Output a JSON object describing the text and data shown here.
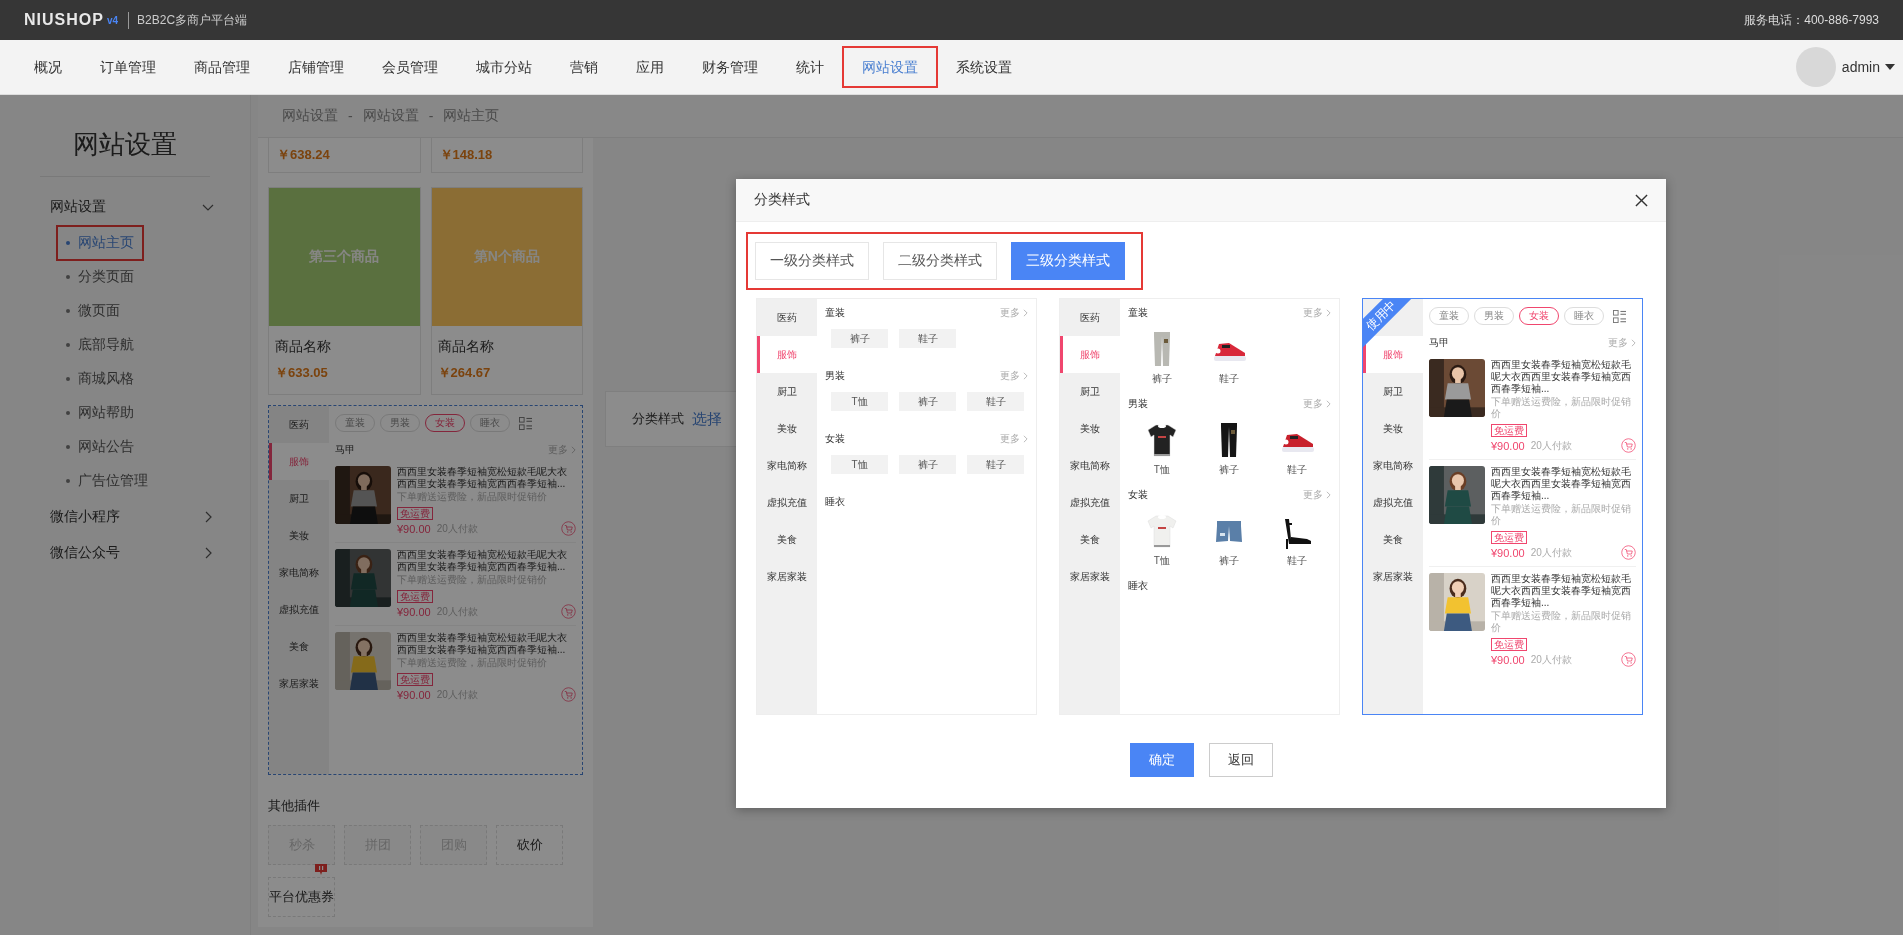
{
  "topbar": {
    "logo": "NIUSHOP",
    "version": "v4",
    "platform": "B2B2C多商户平台端",
    "phone": "服务电话：400-886-7993"
  },
  "nav": {
    "user": "admin",
    "items": [
      {
        "label": "概况",
        "selected": false,
        "annotated": false
      },
      {
        "label": "订单管理",
        "selected": false,
        "annotated": false
      },
      {
        "label": "商品管理",
        "selected": false,
        "annotated": false
      },
      {
        "label": "店铺管理",
        "selected": false,
        "annotated": false
      },
      {
        "label": "会员管理",
        "selected": false,
        "annotated": false
      },
      {
        "label": "城市分站",
        "selected": false,
        "annotated": false
      },
      {
        "label": "营销",
        "selected": false,
        "annotated": false
      },
      {
        "label": "应用",
        "selected": false,
        "annotated": false
      },
      {
        "label": "财务管理",
        "selected": false,
        "annotated": false
      },
      {
        "label": "统计",
        "selected": false,
        "annotated": false
      },
      {
        "label": "网站设置",
        "selected": true,
        "annotated": true
      },
      {
        "label": "系统设置",
        "selected": false,
        "annotated": false
      }
    ]
  },
  "sidebar": {
    "title": "网站设置",
    "groups": [
      {
        "label": "网站设置",
        "expanded": true,
        "children": [
          {
            "label": "网站主页",
            "selected": true,
            "annotated": true
          },
          {
            "label": "分类页面",
            "selected": false,
            "annotated": false
          },
          {
            "label": "微页面",
            "selected": false,
            "annotated": false
          },
          {
            "label": "底部导航",
            "selected": false,
            "annotated": false
          },
          {
            "label": "商城风格",
            "selected": false,
            "annotated": false
          },
          {
            "label": "网站帮助",
            "selected": false,
            "annotated": false
          },
          {
            "label": "网站公告",
            "selected": false,
            "annotated": false
          },
          {
            "label": "广告位管理",
            "selected": false,
            "annotated": false
          }
        ]
      },
      {
        "label": "微信小程序",
        "expanded": false
      },
      {
        "label": "微信公众号",
        "expanded": false
      }
    ]
  },
  "breadcrumb": {
    "separator": "-",
    "items": [
      "网站设置",
      "网站设置",
      "网站主页"
    ]
  },
  "products": {
    "top_prices": [
      "￥638.24",
      "￥148.18"
    ],
    "cards": [
      {
        "image_text": "第三个商品",
        "color": "#5b7040",
        "name": "商品名称",
        "price": "￥633.05"
      },
      {
        "image_text": "第N个商品",
        "color": "#8b6d34",
        "name": "商品名称",
        "price": "￥264.67"
      }
    ]
  },
  "preview": {
    "categories": [
      {
        "label": "医药",
        "selected": false
      },
      {
        "label": "服饰",
        "selected": true
      },
      {
        "label": "厨卫",
        "selected": false
      },
      {
        "label": "美妆",
        "selected": false
      },
      {
        "label": "家电简称",
        "selected": false
      },
      {
        "label": "虚拟充值",
        "selected": false
      },
      {
        "label": "美食",
        "selected": false
      },
      {
        "label": "家居家装",
        "selected": false
      }
    ],
    "tabs": [
      {
        "label": "童装",
        "selected": false
      },
      {
        "label": "男装",
        "selected": false
      },
      {
        "label": "女装",
        "selected": true
      },
      {
        "label": "睡衣",
        "selected": false
      }
    ],
    "section": {
      "title": "马甲",
      "more": "更多"
    },
    "products": [
      {
        "title": "西西里女装春季短袖宽松短款毛呢大衣西西里女装春季短袖宽西西春季短袖...",
        "subtitle": "下单赠送运费险，新品限时促销价",
        "tag": "免运费",
        "price": "¥90.00",
        "sales": "20人付款"
      },
      {
        "title": "西西里女装春季短袖宽松短款毛呢大衣西西里女装春季短袖宽西西春季短袖...",
        "subtitle": "下单赠送运费险，新品限时促销价",
        "tag": "免运费",
        "price": "¥90.00",
        "sales": "20人付款"
      },
      {
        "title": "西西里女装春季短袖宽松短款毛呢大衣西西里女装春季短袖宽西西春季短袖...",
        "subtitle": "下单赠送运费险，新品限时促销价",
        "tag": "免运费",
        "price": "¥90.00",
        "sales": "20人付款"
      }
    ]
  },
  "style_setting": {
    "label": "分类样式",
    "link": "选择"
  },
  "plugins": {
    "title": "其他插件",
    "items": [
      {
        "label": "秒杀",
        "disabled": true,
        "badge": false
      },
      {
        "label": "拼团",
        "disabled": true,
        "badge": false
      },
      {
        "label": "团购",
        "disabled": true,
        "badge": false
      },
      {
        "label": "砍价",
        "disabled": false,
        "badge": false
      },
      {
        "label": "平台优惠券",
        "disabled": false,
        "badge": true
      }
    ]
  },
  "modal": {
    "title": "分类样式",
    "annotated": true,
    "tabs": [
      {
        "label": "一级分类样式",
        "selected": false
      },
      {
        "label": "二级分类样式",
        "selected": false
      },
      {
        "label": "三级分类样式",
        "selected": true
      }
    ],
    "styles": [
      {
        "kind": "level1",
        "in_use": false,
        "categories": [
          {
            "label": "医药",
            "selected": false
          },
          {
            "label": "服饰",
            "selected": true
          },
          {
            "label": "厨卫",
            "selected": false
          },
          {
            "label": "美妆",
            "selected": false
          },
          {
            "label": "家电简称",
            "selected": false
          },
          {
            "label": "虚拟充值",
            "selected": false
          },
          {
            "label": "美食",
            "selected": false
          },
          {
            "label": "家居家装",
            "selected": false
          }
        ],
        "sections": [
          {
            "title": "童装",
            "more": "更多",
            "items": [
              "裤子",
              "鞋子"
            ]
          },
          {
            "title": "男装",
            "more": "更多",
            "items": [
              "T恤",
              "裤子",
              "鞋子"
            ]
          },
          {
            "title": "女装",
            "more": "更多",
            "items": [
              "T恤",
              "裤子",
              "鞋子"
            ]
          },
          {
            "title": "睡衣"
          }
        ]
      },
      {
        "kind": "level2",
        "in_use": false,
        "categories": [
          {
            "label": "医药",
            "selected": false
          },
          {
            "label": "服饰",
            "selected": true
          },
          {
            "label": "厨卫",
            "selected": false
          },
          {
            "label": "美妆",
            "selected": false
          },
          {
            "label": "家电简称",
            "selected": false
          },
          {
            "label": "虚拟充值",
            "selected": false
          },
          {
            "label": "美食",
            "selected": false
          },
          {
            "label": "家居家装",
            "selected": false
          }
        ],
        "sections": [
          {
            "title": "童装",
            "more": "更多",
            "items": [
              "裤子",
              "鞋子"
            ]
          },
          {
            "title": "男装",
            "more": "更多",
            "items": [
              "T恤",
              "裤子",
              "鞋子"
            ]
          },
          {
            "title": "女装",
            "more": "更多",
            "items": [
              "T恤",
              "裤子",
              "鞋子"
            ]
          },
          {
            "title": "睡衣"
          }
        ]
      },
      {
        "kind": "level3",
        "in_use": true,
        "badge": "使用中",
        "categories": [
          {
            "label": "服饰",
            "selected": true
          },
          {
            "label": "厨卫",
            "selected": false
          },
          {
            "label": "美妆",
            "selected": false
          },
          {
            "label": "家电简称",
            "selected": false
          },
          {
            "label": "虚拟充值",
            "selected": false
          },
          {
            "label": "美食",
            "selected": false
          },
          {
            "label": "家居家装",
            "selected": false
          }
        ],
        "tabs": [
          {
            "label": "童装",
            "selected": false
          },
          {
            "label": "男装",
            "selected": false
          },
          {
            "label": "女装",
            "selected": true
          },
          {
            "label": "睡衣",
            "selected": false
          }
        ],
        "section": {
          "title": "马甲",
          "more": "更多"
        },
        "products": [
          {
            "title": "西西里女装春季短袖宽松短款毛呢大衣西西里女装春季短袖宽西西春季短袖...",
            "subtitle": "下单赠送运费险，新品限时促销价",
            "tag": "免运费",
            "price": "¥90.00",
            "sales": "20人付款"
          },
          {
            "title": "西西里女装春季短袖宽松短款毛呢大衣西西里女装春季短袖宽西西春季短袖...",
            "subtitle": "下单赠送运费险，新品限时促销价",
            "tag": "免运费",
            "price": "¥90.00",
            "sales": "20人付款"
          },
          {
            "title": "西西里女装春季短袖宽松短款毛呢大衣西西里女装春季短袖宽西西春季短袖...",
            "subtitle": "下单赠送运费险，新品限时促销价",
            "tag": "免运费",
            "price": "¥90.00",
            "sales": "20人付款"
          }
        ]
      }
    ],
    "buttons": [
      {
        "label": "确定",
        "kind": "primary"
      },
      {
        "label": "返回",
        "kind": "default"
      }
    ]
  }
}
